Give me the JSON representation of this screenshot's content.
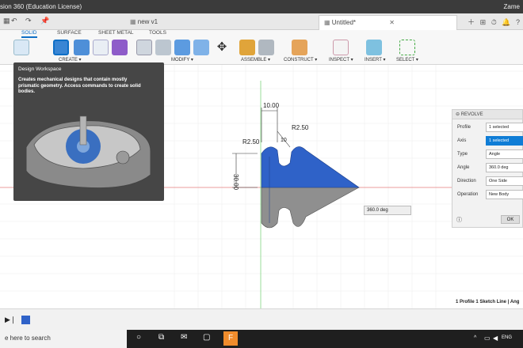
{
  "window": {
    "title": "sion 360 (Education License)",
    "user": "Zame"
  },
  "tabs": [
    {
      "label": "new v1"
    },
    {
      "label": "Untitled*"
    }
  ],
  "ribbon": {
    "tabs": [
      "SOLID",
      "SURFACE",
      "SHEET METAL",
      "TOOLS"
    ],
    "groups": [
      "CREATE ▾",
      "MODIFY ▾",
      "ASSEMBLE ▾",
      "CONSTRUCT ▾",
      "INSPECT ▾",
      "INSERT ▾",
      "SELECT ▾"
    ]
  },
  "tooltip": {
    "title": "Design Workspace",
    "description": "Creates mechanical designs that contain mostly prismatic geometry. Access commands to create solid bodies."
  },
  "sketch": {
    "dim_top": "10.00",
    "dim_r1": "R2.50",
    "dim_r2": "R2.50",
    "dim_height": "30.00",
    "dim_small": "10",
    "angle_input": "360.0 deg"
  },
  "revolve_panel": {
    "title": "REVOLVE",
    "rows": [
      {
        "label": "Profile",
        "value": "1 selected"
      },
      {
        "label": "Axis",
        "value": "1 selected"
      },
      {
        "label": "Type",
        "value": "Angle"
      },
      {
        "label": "Angle",
        "value": "360.0 deg"
      },
      {
        "label": "Direction",
        "value": "One Side"
      },
      {
        "label": "Operation",
        "value": "New Body"
      }
    ],
    "ok": "OK"
  },
  "status": "1 Profile 1 Sketch Line | Ang",
  "taskbar": {
    "search": "e here to search",
    "lang": "ENG"
  },
  "colors": {
    "accent": "#0f7dd6",
    "body": "#2f62c8",
    "cone": "#8f8f8f"
  }
}
